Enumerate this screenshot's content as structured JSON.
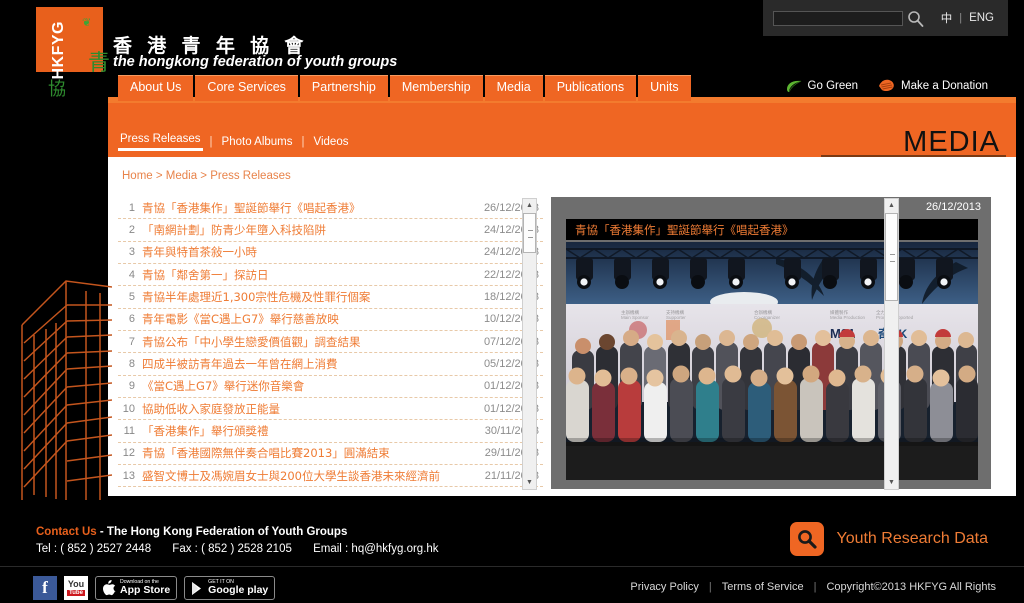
{
  "utility": {
    "search_placeholder": "",
    "search_value": "",
    "search_icon": "search-icon",
    "lang_zh": "中",
    "separator": "|",
    "lang_en": "ENG"
  },
  "header": {
    "logo_text": "HKFYG",
    "org_name_zh": "香 港 青 年 協 會",
    "org_name_en": "the hongkong federation of youth groups"
  },
  "mainnav": {
    "items": [
      {
        "label": "About Us"
      },
      {
        "label": "Core Services"
      },
      {
        "label": "Partnership"
      },
      {
        "label": "Membership"
      },
      {
        "label": "Media"
      },
      {
        "label": "Publications"
      },
      {
        "label": "Units"
      }
    ]
  },
  "sidelinks": {
    "go_green": "Go Green",
    "go_green_icon": "leaf-icon",
    "donation": "Make a Donation",
    "donation_icon": "hands-icon"
  },
  "subnav": {
    "items": [
      {
        "label": "Press Releases",
        "active": true
      },
      {
        "label": "Photo Albums",
        "active": false
      },
      {
        "label": "Videos",
        "active": false
      }
    ],
    "separator": "|",
    "section_title": "MEDIA"
  },
  "breadcrumb": {
    "full": "Home > Media > Press Releases",
    "home": "Home",
    "media": "Media",
    "current": "Press Releases"
  },
  "press_list": {
    "rows": [
      {
        "num": "1",
        "title": "青協「香港集作」聖誕節舉行《唱起香港》",
        "date": "26/12/2013"
      },
      {
        "num": "2",
        "title": "「南網計劃」防青少年墮入科技陷阱",
        "date": "24/12/2013"
      },
      {
        "num": "3",
        "title": "青年與特首茶敍一小時",
        "date": "24/12/2013"
      },
      {
        "num": "4",
        "title": "青協「鄰舍第一」探訪日",
        "date": "22/12/2013"
      },
      {
        "num": "5",
        "title": "青協半年處理近1,300宗性危機及性罪行個案",
        "date": "18/12/2013"
      },
      {
        "num": "6",
        "title": "青年電影《當C遇上G7》舉行慈善放映",
        "date": "10/12/2013"
      },
      {
        "num": "7",
        "title": "青協公布「中小學生戀愛價值觀」調查結果",
        "date": "07/12/2013"
      },
      {
        "num": "8",
        "title": "四成半被訪青年過去一年曾在網上消費",
        "date": "05/12/2013"
      },
      {
        "num": "9",
        "title": "《當C遇上G7》舉行迷你音樂會",
        "date": "01/12/2013"
      },
      {
        "num": "10",
        "title": "協助低收入家庭發放正能量",
        "date": "01/12/2013"
      },
      {
        "num": "11",
        "title": "「香港集作」舉行頒獎禮",
        "date": "30/11/2013"
      },
      {
        "num": "12",
        "title": "青協「香港國際無伴奏合唱比賽2013」圓滿結束",
        "date": "29/11/2013"
      },
      {
        "num": "13",
        "title": "盛智文博士及馮婉眉女士與200位大學生談香港未來經濟前",
        "date": "21/11/2013"
      }
    ]
  },
  "photo_panel": {
    "date": "26/12/2013",
    "title": "青協「香港集作」聖誕節舉行《唱起香港》",
    "backdrop_labels": [
      "M21",
      "奇HK"
    ]
  },
  "footer": {
    "contact_us": "Contact Us",
    "org_line": "- The Hong Kong Federation of Youth Groups",
    "tel_label": "Tel :",
    "tel_value": "( 852 ) 2527 2448",
    "fax_label": "Fax :",
    "fax_value": "( 852 ) 2528 2105",
    "email_label": "Email :",
    "email_value": "hq@hkfyg.org.hk",
    "youth_research": "Youth Research Data",
    "youth_research_icon": "search-badge-icon",
    "privacy": "Privacy Policy",
    "terms": "Terms of Service",
    "copyright": "Copyright©2013 HKFYG All Rights",
    "separator": "|",
    "social": [
      {
        "name": "facebook-icon",
        "label": "f"
      },
      {
        "name": "youtube-icon",
        "label": "You",
        "sub": "Tube"
      },
      {
        "name": "app-store-badge",
        "small": "Download on the",
        "big": "App Store"
      },
      {
        "name": "google-play-badge",
        "small": "GET IT ON",
        "big": "Google play"
      }
    ]
  },
  "colors": {
    "brand_orange": "#ef6623",
    "link_orange": "#ef7c35",
    "background": "#000000",
    "content_bg": "#ffffff",
    "panel_gray": "#6e6e6e"
  }
}
